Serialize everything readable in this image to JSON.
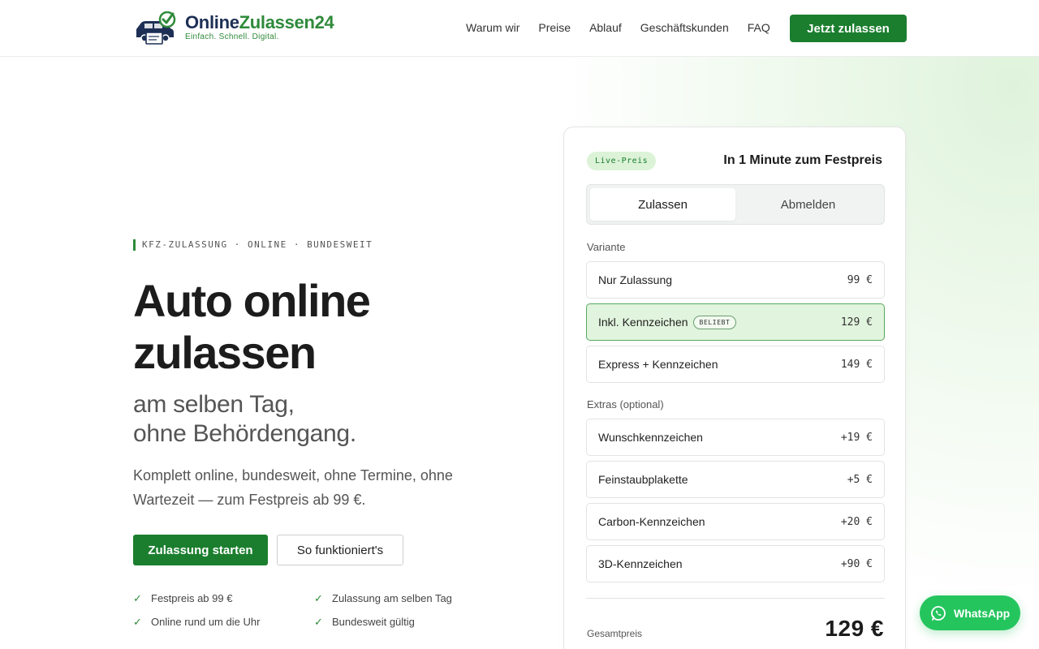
{
  "brand": {
    "name_part1": "Online",
    "name_part2": "Zulassen24",
    "tagline": "Einfach. Schnell. Digital.",
    "colors": {
      "primary_green": "#1b7e2e",
      "navy": "#1d2f55",
      "light_green": "#e1f4dd"
    }
  },
  "nav": {
    "items": [
      "Warum wir",
      "Preise",
      "Ablauf",
      "Geschäftskunden",
      "FAQ"
    ],
    "cta_label": "Jetzt zulassen"
  },
  "hero": {
    "eyebrow": "KFZ-ZULASSUNG · ONLINE · BUNDESWEIT",
    "title_line1": "Auto online",
    "title_line2": "zulassen",
    "subtitle_line1": "am selben Tag,",
    "subtitle_line2": "ohne Behördengang.",
    "lead": "Komplett online, bundesweit, ohne Termine, ohne Wartezeit — zum Festpreis ab 99 €.",
    "primary_button": "Zulassung starten",
    "secondary_button": "So funktioniert's",
    "features": [
      "Festpreis ab 99 €",
      "Zulassung am selben Tag",
      "Online rund um die Uhr",
      "Bundesweit gültig"
    ]
  },
  "calculator": {
    "badge": "Live-Preis",
    "title": "In 1 Minute zum Festpreis",
    "tabs": [
      {
        "label": "Zulassen",
        "active": true
      },
      {
        "label": "Abmelden",
        "active": false
      }
    ],
    "variant_label": "Variante",
    "variants": [
      {
        "label": "Nur Zulassung",
        "price": "99 €",
        "selected": false,
        "badge": ""
      },
      {
        "label": "Inkl. Kennzeichen",
        "price": "129 €",
        "selected": true,
        "badge": "BELIEBT"
      },
      {
        "label": "Express + Kennzeichen",
        "price": "149 €",
        "selected": false,
        "badge": ""
      }
    ],
    "extras_label": "Extras (optional)",
    "extras": [
      {
        "label": "Wunschkennzeichen",
        "price": "+19 €"
      },
      {
        "label": "Feinstaubplakette",
        "price": "+5 €"
      },
      {
        "label": "Carbon-Kennzeichen",
        "price": "+20 €"
      },
      {
        "label": "3D-Kennzeichen",
        "price": "+90 €"
      }
    ],
    "total_label": "Gesamtpreis",
    "total_value": "129 €"
  },
  "whatsapp": {
    "label": "WhatsApp",
    "icon": "whatsapp-icon"
  }
}
